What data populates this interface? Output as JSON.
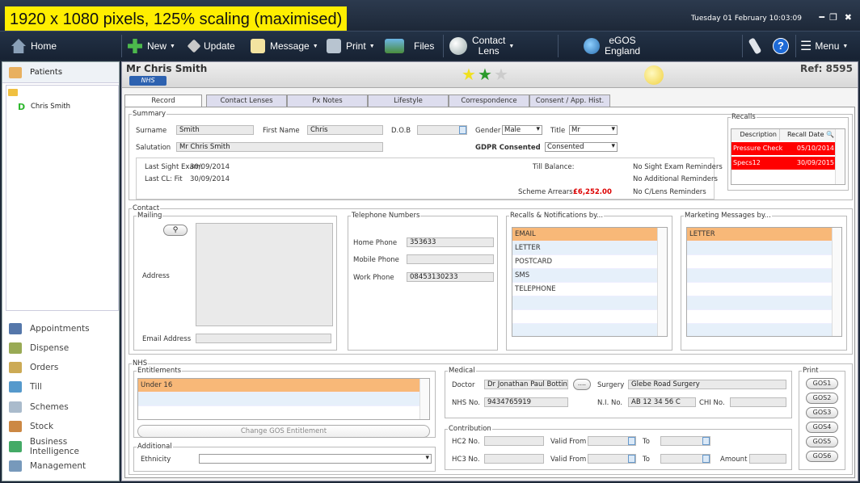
{
  "overlay_label": "1920 x 1080 pixels, 125% scaling (maximised)",
  "datetime": "Tuesday 01 February 10:03:09",
  "toolbar": {
    "home": "Home",
    "new": "New",
    "update": "Update",
    "message": "Message",
    "print": "Print",
    "files": "Files",
    "contact_lens_1": "Contact",
    "contact_lens_2": "Lens",
    "egos_1": "eGOS",
    "egos_2": "England",
    "menu": "Menu"
  },
  "nav": {
    "patients": "Patients",
    "tree_patient": "Chris Smith",
    "items": [
      "Appointments",
      "Dispense",
      "Orders",
      "Till",
      "Schemes",
      "Stock",
      "Business Intelligence",
      "Management"
    ]
  },
  "header": {
    "patient_name": "Mr Chris Smith",
    "badge": "NHS",
    "ref": "Ref: 8595"
  },
  "tabs": [
    "Record",
    "Contact Lenses",
    "Px Notes",
    "Lifestyle",
    "Correspondence",
    "Consent / App. Hist."
  ],
  "summary": {
    "legend": "Summary",
    "surname_label": "Surname",
    "surname": "Smith",
    "firstname_label": "First Name",
    "firstname": "Chris",
    "dob_label": "D.O.B",
    "gender_label": "Gender",
    "gender": "Male",
    "title_label": "Title",
    "title": "Mr",
    "salutation_label": "Salutation",
    "salutation": "Mr Chris Smith",
    "gdpr_label": "GDPR Consented",
    "gdpr": "Consented",
    "last_sight_label": "Last Sight Exam:",
    "last_sight": "30/09/2014",
    "last_cl_label": "Last CL: Fit",
    "last_cl": "30/09/2014",
    "till_balance_label": "Till Balance:",
    "scheme_arrears_label": "Scheme Arrears:",
    "scheme_arrears": "£6,252.00",
    "reminder1": "No Sight Exam Reminders",
    "reminder2": "No Additional Reminders",
    "reminder3": "No C/Lens Reminders"
  },
  "recalls": {
    "legend": "Recalls",
    "col1": "Description",
    "col2": "Recall Date",
    "rows": [
      {
        "desc": "Pressure Check",
        "date": "05/10/2014"
      },
      {
        "desc": "Specs12",
        "date": "30/09/2015"
      }
    ]
  },
  "contact": {
    "legend": "Contact",
    "mailing_legend": "Mailing",
    "address_label": "Address",
    "email_label": "Email Address",
    "tel_legend": "Telephone Numbers",
    "home_label": "Home Phone",
    "home": "353633",
    "mobile_label": "Mobile Phone",
    "mobile": "",
    "work_label": "Work Phone",
    "work": "08453130233",
    "recall_notif_legend": "Recalls & Notifications by...",
    "recall_notif": [
      "EMAIL",
      "LETTER",
      "POSTCARD",
      "SMS",
      "TELEPHONE"
    ],
    "marketing_legend": "Marketing Messages by...",
    "marketing": [
      "LETTER"
    ]
  },
  "nhs": {
    "legend": "NHS",
    "entitlements_legend": "Entitlements",
    "entitlements": [
      "Under 16"
    ],
    "change_btn": "Change GOS Entitlement",
    "additional_legend": "Additional",
    "ethnicity_label": "Ethnicity",
    "medical_legend": "Medical",
    "doctor_label": "Doctor",
    "doctor": "Dr Jonathan Paul Botting",
    "doctor_btn": "....",
    "surgery_label": "Surgery",
    "surgery": "Glebe Road Surgery",
    "nhs_no_label": "NHS No.",
    "nhs_no": "9434765919",
    "ni_no_label": "N.I. No.",
    "ni_no": "AB 12 34 56 C",
    "chi_label": "CHI No.",
    "contribution_legend": "Contribution",
    "hc2_label": "HC2 No.",
    "hc3_label": "HC3 No.",
    "valid_from_label": "Valid From",
    "to_label": "To",
    "amount_label": "Amount",
    "print_legend": "Print",
    "gos": [
      "GOS1",
      "GOS2",
      "GOS3",
      "GOS4",
      "GOS5",
      "GOS6"
    ]
  },
  "colors": {
    "accent_blue": "#2d62b0",
    "selected_orange": "#f8b878",
    "recall_red": "#ff0000"
  }
}
